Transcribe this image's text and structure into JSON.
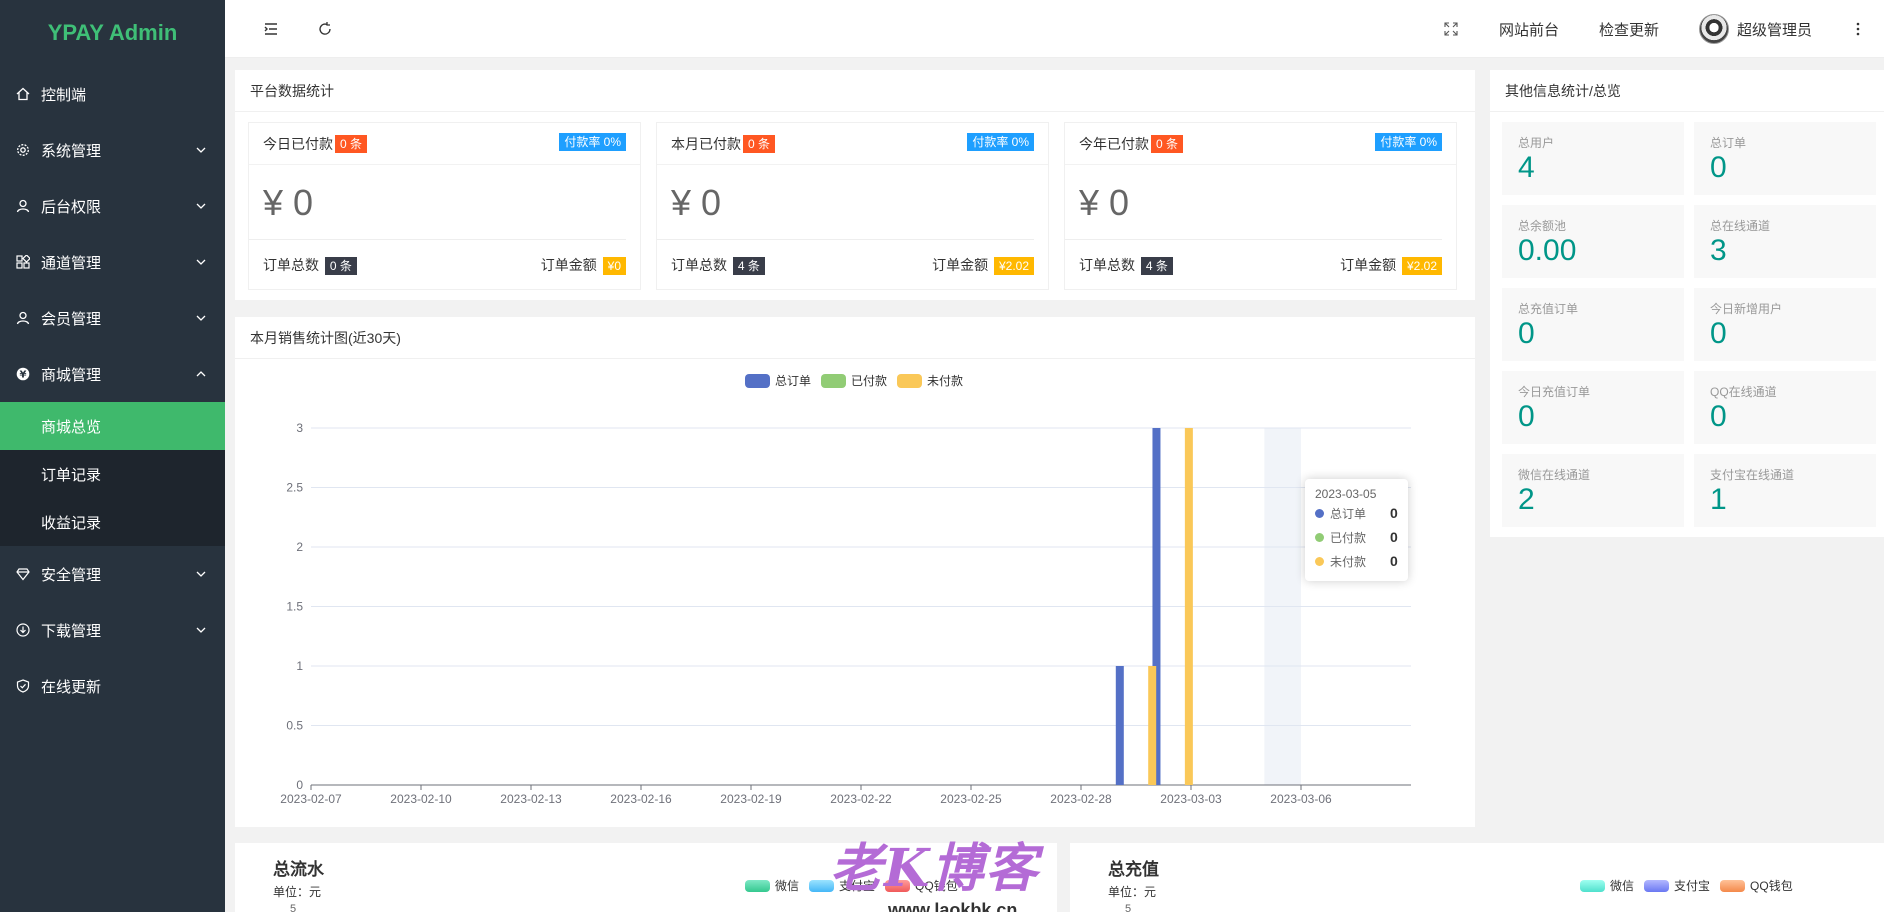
{
  "app": {
    "logo": "YPAY Admin"
  },
  "sidebar": {
    "items": [
      {
        "label": "控制端",
        "icon": "home-icon"
      },
      {
        "label": "系统管理",
        "icon": "gear-icon"
      },
      {
        "label": "后台权限",
        "icon": "user-icon"
      },
      {
        "label": "通道管理",
        "icon": "apps-icon"
      },
      {
        "label": "会员管理",
        "icon": "user-icon"
      },
      {
        "label": "商城管理",
        "icon": "yen-icon"
      },
      {
        "label": "安全管理",
        "icon": "diamond-icon"
      },
      {
        "label": "下载管理",
        "icon": "download-icon"
      },
      {
        "label": "在线更新",
        "icon": "shield-check-icon"
      }
    ],
    "subitems": [
      {
        "label": "商城总览"
      },
      {
        "label": "订单记录"
      },
      {
        "label": "收益记录"
      }
    ]
  },
  "header": {
    "site_front": "网站前台",
    "check_update": "检查更新",
    "username": "超级管理员"
  },
  "platform": {
    "title": "平台数据统计",
    "cards": [
      {
        "title": "今日已付款",
        "count": "0 条",
        "rate": "付款率 0%",
        "amount": "¥ 0",
        "total_label": "订单总数",
        "total": "0 条",
        "money_label": "订单金额",
        "money": "¥0"
      },
      {
        "title": "本月已付款",
        "count": "0 条",
        "rate": "付款率 0%",
        "amount": "¥ 0",
        "total_label": "订单总数",
        "total": "4 条",
        "money_label": "订单金额",
        "money": "¥2.02"
      },
      {
        "title": "今年已付款",
        "count": "0 条",
        "rate": "付款率 0%",
        "amount": "¥ 0",
        "total_label": "订单总数",
        "total": "4 条",
        "money_label": "订单金额",
        "money": "¥2.02"
      }
    ]
  },
  "info": {
    "title": "其他信息统计/总览",
    "cells": [
      {
        "label": "总用户",
        "value": "4"
      },
      {
        "label": "总订单",
        "value": "0"
      },
      {
        "label": "总余额池",
        "value": "0.00"
      },
      {
        "label": "总在线通道",
        "value": "3"
      },
      {
        "label": "总充值订单",
        "value": "0"
      },
      {
        "label": "今日新增用户",
        "value": "0"
      },
      {
        "label": "今日充值订单",
        "value": "0"
      },
      {
        "label": "QQ在线通道",
        "value": "0"
      },
      {
        "label": "微信在线通道",
        "value": "2"
      },
      {
        "label": "支付宝在线通道",
        "value": "1"
      }
    ]
  },
  "chart_panel": {
    "title": "本月销售统计图(近30天)"
  },
  "chart_data": {
    "type": "bar",
    "title": "",
    "xlabel": "",
    "ylabel": "",
    "ylim": [
      0,
      3
    ],
    "yticks": [
      "0",
      "0.5",
      "1",
      "1.5",
      "2",
      "2.5",
      "3"
    ],
    "xticks": [
      "2023-02-07",
      "2023-02-10",
      "2023-02-13",
      "2023-02-16",
      "2023-02-19",
      "2023-02-22",
      "2023-02-25",
      "2023-02-28",
      "2023-03-03",
      "2023-03-06"
    ],
    "categories": [
      "2023-02-07",
      "2023-02-08",
      "2023-02-09",
      "2023-02-10",
      "2023-02-11",
      "2023-02-12",
      "2023-02-13",
      "2023-02-14",
      "2023-02-15",
      "2023-02-16",
      "2023-02-17",
      "2023-02-18",
      "2023-02-19",
      "2023-02-20",
      "2023-02-21",
      "2023-02-22",
      "2023-02-23",
      "2023-02-24",
      "2023-02-25",
      "2023-02-26",
      "2023-02-27",
      "2023-02-28",
      "2023-03-01",
      "2023-03-02",
      "2023-03-03",
      "2023-03-04",
      "2023-03-05",
      "2023-03-06",
      "2023-03-07",
      "2023-03-08"
    ],
    "series": [
      {
        "name": "总订单",
        "color": "#5470c6",
        "values": [
          0,
          0,
          0,
          0,
          0,
          0,
          0,
          0,
          0,
          0,
          0,
          0,
          0,
          0,
          0,
          0,
          0,
          0,
          0,
          0,
          0,
          0,
          1,
          3,
          0,
          0,
          0,
          0,
          0,
          0
        ]
      },
      {
        "name": "已付款",
        "color": "#91cc75",
        "values": [
          0,
          0,
          0,
          0,
          0,
          0,
          0,
          0,
          0,
          0,
          0,
          0,
          0,
          0,
          0,
          0,
          0,
          0,
          0,
          0,
          0,
          0,
          0,
          0,
          0,
          0,
          0,
          0,
          0,
          0
        ]
      },
      {
        "name": "未付款",
        "color": "#fac858",
        "values": [
          0,
          0,
          0,
          0,
          0,
          0,
          0,
          0,
          0,
          0,
          0,
          0,
          0,
          0,
          0,
          0,
          0,
          0,
          0,
          0,
          0,
          0,
          1,
          3,
          0,
          0,
          0,
          0,
          0,
          0
        ]
      }
    ],
    "grid": true,
    "legend": "top-center",
    "tooltip": {
      "date": "2023-03-05",
      "rows": [
        {
          "name": "总订单",
          "value": "0"
        },
        {
          "name": "已付款",
          "value": "0"
        },
        {
          "name": "未付款",
          "value": "0"
        }
      ]
    }
  },
  "bottom": {
    "flow": {
      "title": "总流水",
      "unit": "单位：元",
      "legend": [
        "微信",
        "支付宝",
        "QQ钱包"
      ],
      "first_tick": "5"
    },
    "recharge": {
      "title": "总充值",
      "unit": "单位：元",
      "legend": [
        "微信",
        "支付宝",
        "QQ钱包"
      ],
      "first_tick": "5"
    }
  },
  "watermark": {
    "text": "老K博客",
    "url": "www.laokbk.cn"
  }
}
